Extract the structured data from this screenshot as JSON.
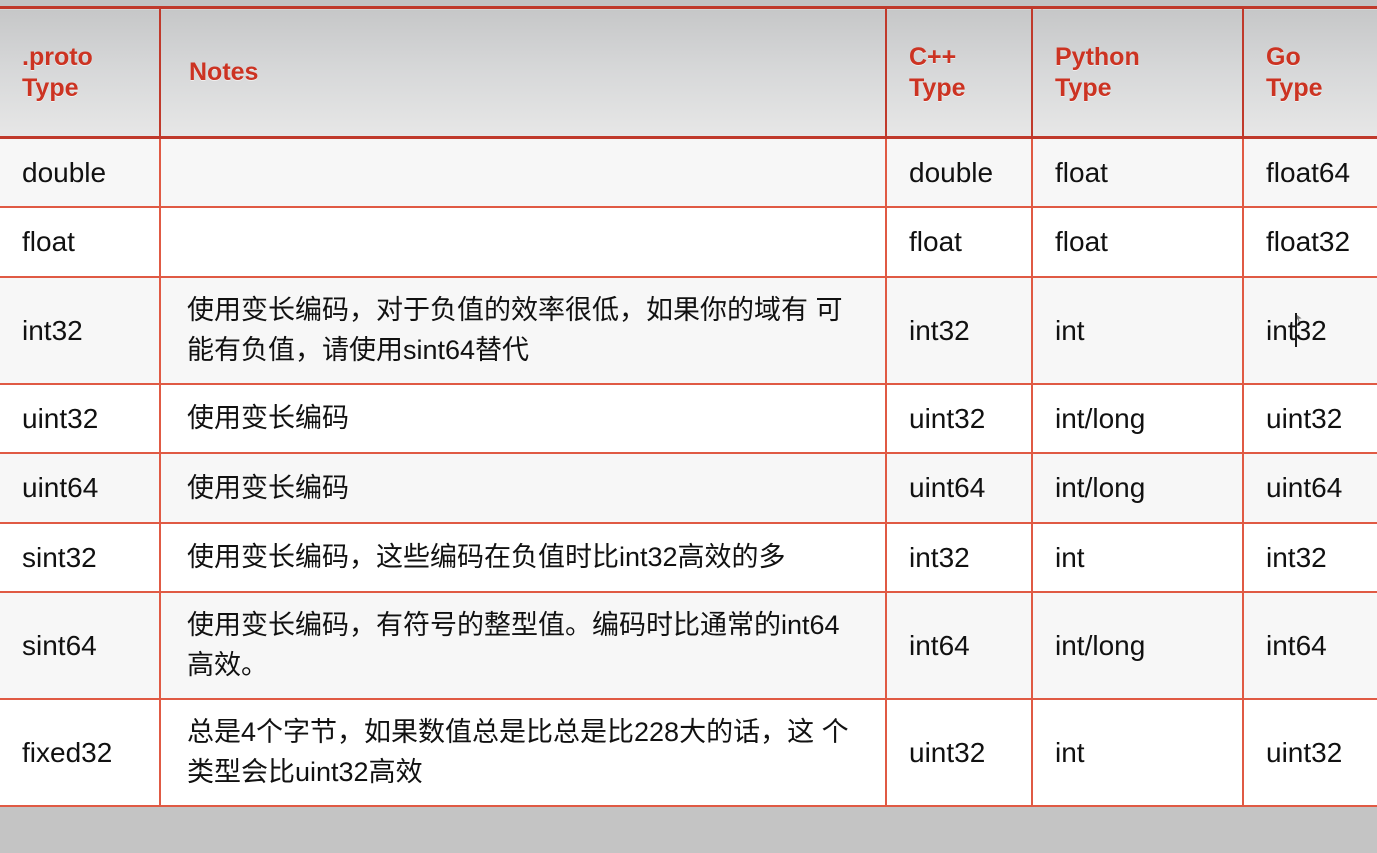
{
  "document": {
    "kind": "protobuf-scalar-types-table"
  },
  "table": {
    "headers": {
      "proto_line1": ".proto",
      "proto_line2": "Type",
      "notes": "Notes",
      "cpp_line1": "C++",
      "cpp_line2": "Type",
      "python_line1": "Python",
      "python_line2": "Type",
      "go_line1": "Go",
      "go_line2": "Type"
    },
    "rows": [
      {
        "proto": "double",
        "notes": "",
        "cpp": "double",
        "python": "float",
        "go": "float64"
      },
      {
        "proto": "float",
        "notes": "",
        "cpp": "float",
        "python": "float",
        "go": "float32"
      },
      {
        "proto": "int32",
        "notes": "使用变长编码，对于负值的效率很低，如果你的域有 可能有负值，请使用sint64替代",
        "cpp": "int32",
        "python": "int",
        "go_before_caret": "int",
        "go_after_caret": "32",
        "go": "int32"
      },
      {
        "proto": "uint32",
        "notes": "使用变长编码",
        "cpp": "uint32",
        "python": "int/long",
        "go": "uint32"
      },
      {
        "proto": "uint64",
        "notes": "使用变长编码",
        "cpp": "uint64",
        "python": "int/long",
        "go": "uint64"
      },
      {
        "proto": "sint32",
        "notes": "使用变长编码，这些编码在负值时比int32高效的多",
        "cpp": "int32",
        "python": "int",
        "go": "int32"
      },
      {
        "proto": "sint64",
        "notes": "使用变长编码，有符号的整型值。编码时比通常的int64高效。",
        "cpp": "int64",
        "python": "int/long",
        "go": "int64"
      },
      {
        "proto": "fixed32",
        "notes": "总是4个字节，如果数值总是比总是比228大的话，这 个类型会比uint32高效",
        "cpp": "uint32",
        "python": "int",
        "go": "uint32"
      }
    ]
  },
  "colors": {
    "accent_red": "#cc3322",
    "border_red": "#e05a44",
    "header_gradient_top": "#c6c7c8",
    "header_gradient_bottom": "#e7e7e7",
    "row_tint": "#f7f7f7",
    "row_plain": "#ffffff",
    "page_background": "#c4c4c4"
  }
}
